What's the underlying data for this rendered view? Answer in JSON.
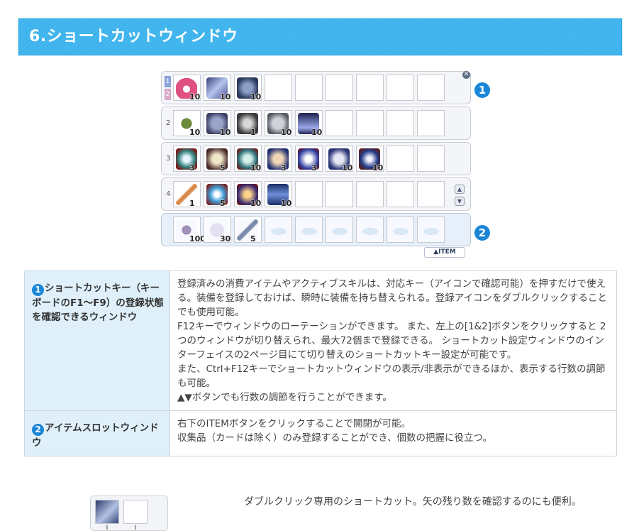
{
  "section": {
    "title": "6.ショートカットウィンドウ"
  },
  "shortcut_window": {
    "rows": [
      {
        "label": "",
        "toggles": [
          "1",
          "2"
        ],
        "slots": [
          {
            "icon": "heart-cross-icon",
            "count": "10"
          },
          {
            "icon": "magic-skill-icon",
            "count": "10"
          },
          {
            "icon": "gear-skill-icon",
            "count": "10"
          },
          null,
          null,
          null,
          null,
          null,
          null
        ]
      },
      {
        "label": "2",
        "slots": [
          {
            "icon": "clover-icon",
            "count": "10"
          },
          {
            "icon": "mask-skill-icon",
            "count": "10"
          },
          {
            "icon": "skull-skill-icon",
            "count": "1"
          },
          {
            "icon": "spirit-skill-icon",
            "count": "10"
          },
          {
            "icon": "glow-skill-icon",
            "count": "10"
          },
          null,
          null,
          null,
          null
        ]
      },
      {
        "label": "3",
        "slots": [
          {
            "icon": "holy-light-icon",
            "count": "3"
          },
          {
            "icon": "star-shield-icon",
            "count": "5"
          },
          {
            "icon": "angel-icon",
            "count": "10"
          },
          {
            "icon": "wing-icon",
            "count": "3"
          },
          {
            "icon": "sparkle-icon",
            "count": "3"
          },
          {
            "icon": "cross-orb-icon",
            "count": "10"
          },
          {
            "icon": "sword-aura-icon",
            "count": "10"
          },
          null,
          null
        ]
      },
      {
        "label": "4",
        "slots": [
          {
            "icon": "staff-icon",
            "count": "1"
          },
          {
            "icon": "light-burst-icon",
            "count": "5"
          },
          {
            "icon": "flame-hand-icon",
            "count": "10"
          },
          {
            "icon": "rain-skill-icon",
            "count": "10"
          },
          null,
          null,
          null,
          null,
          null
        ]
      }
    ],
    "item_row": {
      "slots": [
        {
          "icon": "gem-icon",
          "count": "100"
        },
        {
          "icon": "cotton-icon",
          "count": "30"
        },
        {
          "icon": "feather-icon",
          "count": "5"
        },
        null,
        null,
        null,
        null,
        null,
        null
      ]
    },
    "item_button": "▲ITEM",
    "callout_1": "1",
    "callout_2": "2",
    "close": "✕",
    "scroll_up": "▲",
    "scroll_down": "▼"
  },
  "table": [
    {
      "num": "1",
      "title": "ショートカットキー（キーボードのF1～F9）の登録状態を確認できるウィンドウ",
      "lines": [
        "登録済みの消費アイテムやアクティブスキルは、対応キー（アイコンで確認可能）を押すだけで使える。装備を登録しておけば、瞬時に装備を持ち替えられる。登録アイコンをダブルクリックすることでも使用可能。",
        "F12キーでウィンドウのローテーションができます。 また、左上の[1&2]ボタンをクリックすると 2つのウィンドウが切り替えられ、最大72個まで登録できる。 ショートカット設定ウィンドウのインターフェイスの2ページ目にて切り替えのショートカットキー設定が可能です。",
        "また、Ctrl+F12キーでショートカットウィンドウの表示/非表示ができるほか、表示する行数の調節も可能。",
        "▲▼ボタンでも行数の調節を行うことができます。"
      ]
    },
    {
      "num": "2",
      "title": "アイテムスロットウィンドウ",
      "lines": [
        "右下のITEMボタンをクリックすることで開閉が可能。",
        "収集品（カードは除く）のみ登録することができ、個数の把握に役立つ。"
      ]
    }
  ],
  "bottom": {
    "text": "ダブルクリック専用のショートカット。矢の残り数を確認するのにも便利。",
    "arrows": [
      "I",
      "I"
    ]
  },
  "colors": {
    "header": "#3db2ec",
    "badge": "#1a86d6",
    "table_head_bg": "#dff0fb"
  }
}
